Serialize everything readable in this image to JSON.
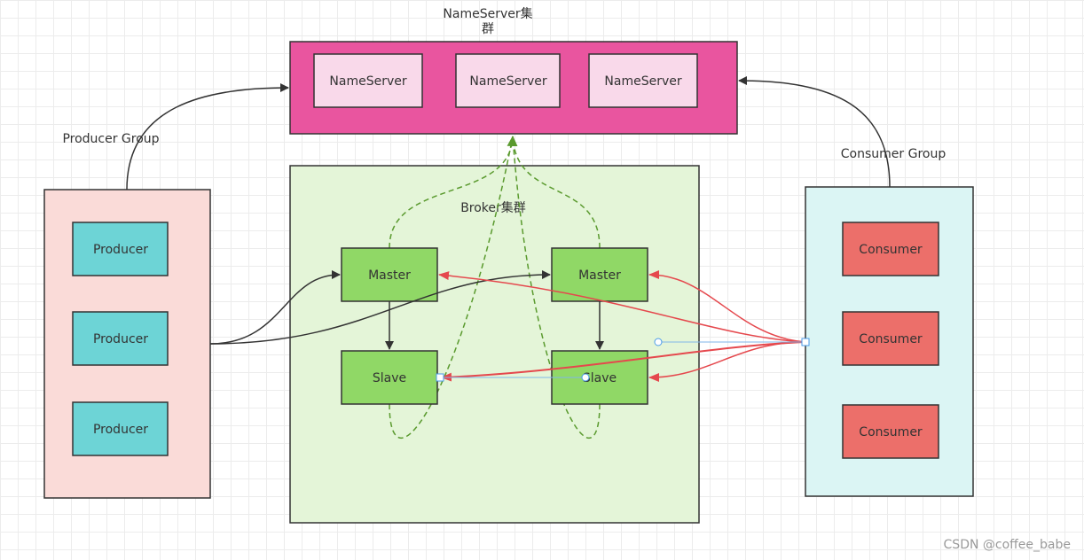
{
  "nameserver_cluster": {
    "title_line1": "NameServer集",
    "title_line2": "群",
    "servers": [
      "NameServer",
      "NameServer",
      "NameServer"
    ]
  },
  "producer_group": {
    "label": "Producer Group",
    "producers": [
      "Producer",
      "Producer",
      "Producer"
    ]
  },
  "broker_cluster": {
    "label": "Broker集群",
    "masters": [
      "Master",
      "Master"
    ],
    "slaves": [
      "Slave",
      "Slave"
    ]
  },
  "consumer_group": {
    "label": "Consumer Group",
    "consumers": [
      "Consumer",
      "Consumer",
      "Consumer"
    ]
  },
  "watermark": "CSDN @coffee_babe",
  "colors": {
    "nameserver_bg": "#e9559f",
    "nameserver_box": "#f9d9ea",
    "producer_bg": "#fadbd8",
    "producer_box": "#6dd4d6",
    "broker_bg": "#e4f5d8",
    "broker_box": "#90d866",
    "consumer_bg": "#dbf5f4",
    "consumer_box": "#ec6f6a",
    "red_edge": "#e5484d",
    "green_edge": "#5a9a2e"
  }
}
